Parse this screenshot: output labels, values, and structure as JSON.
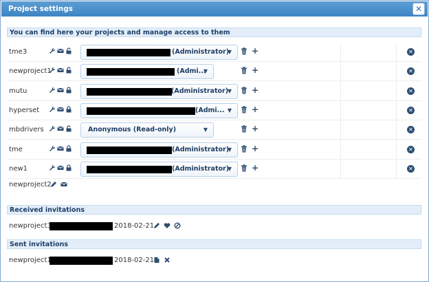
{
  "window": {
    "title": "Project settings",
    "close_symbol": "✕"
  },
  "projects_section": {
    "header": "You can find here your projects and manage access to them"
  },
  "projects": [
    {
      "name": "tme3",
      "role": "(Administrator)",
      "lock": "open"
    },
    {
      "name": "newproject1",
      "role": "(Admi...",
      "lock": "open"
    },
    {
      "name": "mutu",
      "role": "(Administrator)",
      "lock": "closed"
    },
    {
      "name": "hyperset",
      "role": "(Admi...",
      "lock": "closed"
    },
    {
      "name": "mbdrivers",
      "role": "Anonymous (Read-only)",
      "lock": "open"
    },
    {
      "name": "tme",
      "role": "(Administrator)",
      "lock": "closed"
    },
    {
      "name": "new1",
      "role": "(Administrator)",
      "lock": "closed"
    }
  ],
  "pending_project": {
    "name": "newproject2"
  },
  "received_section": {
    "header": "Received invitations"
  },
  "received": [
    {
      "project": "newproject3",
      "date": "2018-02-21"
    }
  ],
  "sent_section": {
    "header": "Sent invitations"
  },
  "sent": [
    {
      "project": "newproject1",
      "date": "2018-02-21"
    }
  ],
  "icons": {
    "settings": "wrench-icon",
    "mail": "envelope-icon",
    "lock": "lock-icon",
    "trash": "trash-icon",
    "add": "plus-icon",
    "remove": "remove-circle-icon",
    "edit": "pencil-icon",
    "accept": "heart-icon",
    "decline": "ban-icon",
    "file": "file-icon",
    "cancel": "x-icon"
  },
  "colors": {
    "titlebar": "#4a90cf",
    "section_bg": "#e3eefa",
    "icon": "#2e4d70"
  }
}
